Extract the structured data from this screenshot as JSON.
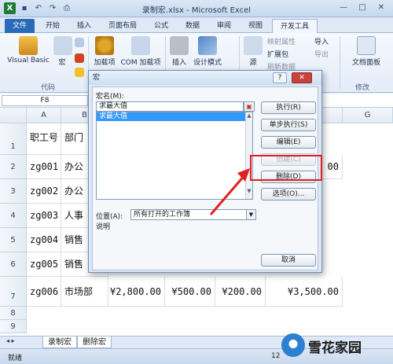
{
  "window": {
    "title": "录制宏.xlsx - Microsoft Excel",
    "logo": "X",
    "controls": [
      "—",
      "□",
      "✕"
    ]
  },
  "tabs": [
    {
      "label": "文件",
      "kind": "file"
    },
    {
      "label": "开始"
    },
    {
      "label": "插入"
    },
    {
      "label": "页面布局"
    },
    {
      "label": "公式"
    },
    {
      "label": "数据"
    },
    {
      "label": "审阅"
    },
    {
      "label": "视图"
    },
    {
      "label": "开发工具",
      "kind": "active"
    }
  ],
  "ribbon": {
    "code_group": {
      "label": "代码",
      "visual_basic": "Visual Basic",
      "macro": "宏"
    },
    "addins": {
      "addins": "加载项",
      "com_addins": "COM 加载项"
    },
    "controls": {
      "insert": "插入",
      "design_mode": "设计模式"
    },
    "xml": {
      "source": "源",
      "map_props": "映射属性",
      "expansion": "扩展包",
      "refresh": "刷新数据",
      "import": "导入",
      "export": "导出"
    },
    "modify": {
      "doc_panel": "文档面板",
      "label": "修改"
    }
  },
  "formula_bar": {
    "name_box": "F8"
  },
  "grid": {
    "columns": [
      "A",
      "B",
      "C",
      "D",
      "E",
      "F",
      "G"
    ],
    "rows": [
      {
        "num": "1",
        "cells": [
          "职工号",
          "部门"
        ]
      },
      {
        "num": "2",
        "cells": [
          "zg001",
          "办公"
        ],
        "f": "00"
      },
      {
        "num": "3",
        "cells": [
          "zg002",
          "办公"
        ],
        "f": ""
      },
      {
        "num": "4",
        "cells": [
          "zg003",
          "人事"
        ],
        "f": ""
      },
      {
        "num": "5",
        "cells": [
          "zg004",
          "销售"
        ],
        "f": ""
      },
      {
        "num": "6",
        "cells": [
          "zg005",
          "销售"
        ],
        "f": ""
      },
      {
        "num": "7",
        "cells": [
          "zg006",
          "市场部"
        ],
        "c": "¥2,800.00",
        "d": "¥500.00",
        "e": "¥200.00",
        "f": "¥3,500.00"
      },
      {
        "num": "8",
        "cells": []
      },
      {
        "num": "9",
        "cells": []
      }
    ]
  },
  "sheets": [
    "录制宏",
    "删除宏"
  ],
  "status": {
    "ready": "就绪",
    "zoom": "12"
  },
  "dialog": {
    "title": "宏",
    "help": "?",
    "close": "✕",
    "macro_name_label": "宏名(M):",
    "macro_name_value": "求最大值",
    "list_items": [
      "求最大值"
    ],
    "buttons": {
      "run": "执行(R)",
      "step": "单步执行(S)",
      "edit": "编辑(E)",
      "create": "创建(C)",
      "delete": "删除(D)",
      "options": "选项(O)...",
      "cancel": "取消"
    },
    "location_label": "位置(A):",
    "location_value": "所有打开的工作簿",
    "description_label": "说明"
  },
  "watermark": {
    "text": "雪花家园"
  },
  "colors": {
    "accent": "#2a6ab8",
    "selection": "#3399ff",
    "annotation": "#e02020"
  }
}
